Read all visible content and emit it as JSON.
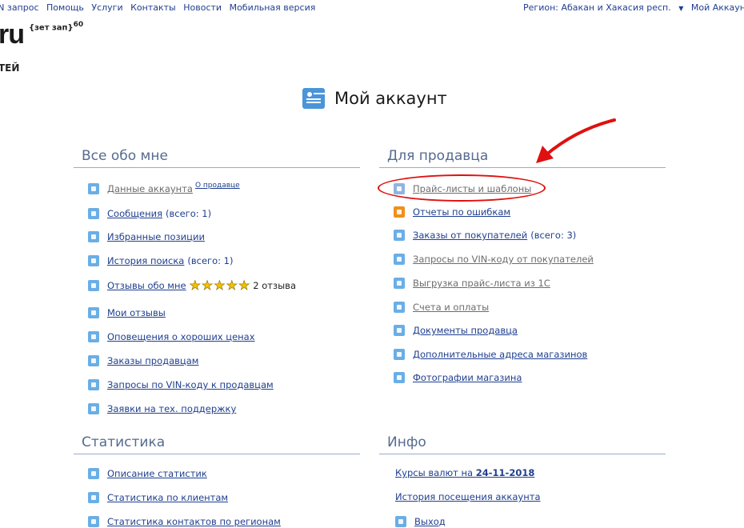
{
  "topbar": {
    "nav": [
      "IN запрос",
      "Помощь",
      "Услуги",
      "Контакты",
      "Новости",
      "Мобильная версия"
    ],
    "region_label": "Регион: Абакан и Хакасия респ.",
    "account_label": "Мой Аккаун"
  },
  "logo": {
    "main": "ru",
    "sup_text": "{зет зап}",
    "sup_num": "60",
    "sub": "ТЕЙ"
  },
  "page": {
    "title": "Мой аккаунт"
  },
  "about": {
    "heading": "Все обо мне",
    "items": [
      {
        "label": "Данные аккаунта",
        "extra": "О продавце",
        "icon": "user-icon"
      },
      {
        "label": "Сообщения",
        "count": "(всего: 1)",
        "icon": "message-icon"
      },
      {
        "label": "Избранные позиции",
        "icon": "heart-icon"
      },
      {
        "label": "История поиска",
        "count": "(всего: 1)",
        "icon": "history-icon"
      },
      {
        "label": "Отзывы обо мне",
        "reviews": "2 отзыва",
        "rating": 5,
        "icon": "star-icon"
      },
      {
        "label": "Мои отзывы",
        "icon": "star-icon"
      },
      {
        "label": "Оповещения о хороших ценах",
        "icon": "bell-icon"
      },
      {
        "label": "Заказы продавцам",
        "icon": "cart-icon"
      },
      {
        "label": "Запросы по VIN-коду к продавцам",
        "icon": "car-icon"
      },
      {
        "label": "Заявки на тех. поддержку",
        "icon": "support-icon"
      }
    ]
  },
  "seller": {
    "heading": "Для продавца",
    "items": [
      {
        "label": "Прайс-листы и шаблоны",
        "icon": "grid-icon"
      },
      {
        "label": "Отчеты по ошибкам",
        "icon": "warning-icon"
      },
      {
        "label": "Заказы от покупателей",
        "count": "(всего: 3)",
        "icon": "cart-icon"
      },
      {
        "label": "Запросы по VIN-коду от покупателей",
        "icon": "car-icon"
      },
      {
        "label": "Выгрузка прайс-листа из 1С",
        "icon": "download-icon"
      },
      {
        "label": "Счета и оплаты",
        "icon": "money-icon"
      },
      {
        "label": "Документы продавца",
        "icon": "document-icon"
      },
      {
        "label": "Дополнительные адреса магазинов",
        "icon": "home-icon"
      },
      {
        "label": "Фотографии магазина",
        "icon": "photo-icon"
      }
    ]
  },
  "stats": {
    "heading": "Статистика",
    "items": [
      {
        "label": "Описание статистик",
        "icon": "info-icon"
      },
      {
        "label": "Статистика по клиентам",
        "icon": "chart-icon"
      },
      {
        "label": "Статистика контактов по регионам",
        "icon": "chart-icon"
      }
    ]
  },
  "info": {
    "heading": "Инфо",
    "rates_prefix": "Курсы валют на ",
    "rates_date": "24-11-2018",
    "history": "История посещения аккаунта",
    "logout": "Выход"
  },
  "colors": {
    "link": "#1f3f8f",
    "heading": "#556b8e",
    "icon": "#6aaee6",
    "annotation": "#e01010"
  }
}
